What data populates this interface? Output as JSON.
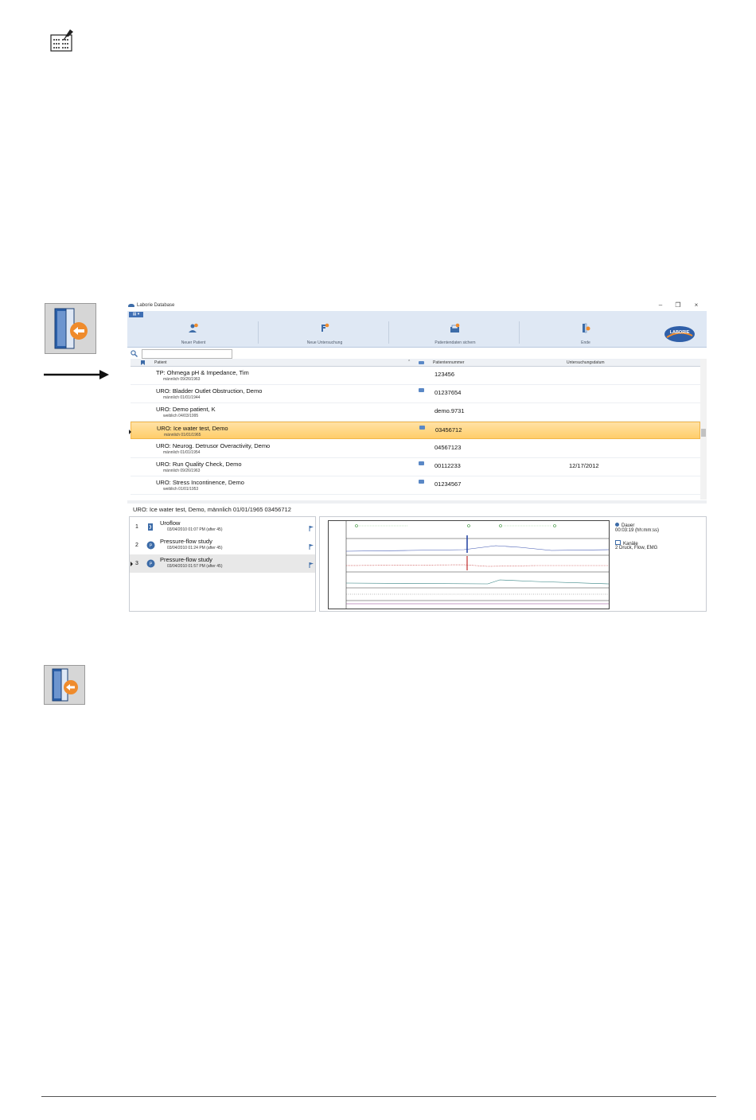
{
  "window": {
    "title": "Laborie Database",
    "minimize": "–",
    "restore": "❐",
    "close": "×",
    "menu_button": "▤ ▾"
  },
  "ribbon": {
    "buttons": [
      {
        "label": "Neuer Patient",
        "icon": "new-patient-icon"
      },
      {
        "label": "Neue Untersuchung",
        "icon": "new-examination-icon"
      },
      {
        "label": "Patientendaten sichern",
        "icon": "save-patient-data-icon"
      },
      {
        "label": "Ende",
        "icon": "exit-icon"
      }
    ],
    "logo": "LABORIE"
  },
  "table": {
    "headers": {
      "patient": "Patient",
      "sort": "⌃",
      "number": "Patientennummer",
      "date": "Untersuchungsdatum"
    },
    "rows": [
      {
        "name": "TP: Ohmega pH & Impedance, Tim",
        "sub": "männlich 09/26/1963",
        "number": "123456",
        "date": "",
        "has_file": false,
        "selected": false
      },
      {
        "name": "URO: Bladder Outlet Obstruction, Demo",
        "sub": "männlich 01/01/1944",
        "number": "01237654",
        "date": "",
        "has_file": true,
        "selected": false
      },
      {
        "name": "URO: Demo patient, K",
        "sub": "weiblich 04/03/1995",
        "number": "demo.9731",
        "date": "",
        "has_file": false,
        "selected": false
      },
      {
        "name": "URO: Ice water test, Demo",
        "sub": "männlich 01/01/1965",
        "number": "03456712",
        "date": "",
        "has_file": true,
        "selected": true
      },
      {
        "name": "URO: Neurog. Detrusor Overactivity, Demo",
        "sub": "männlich 01/01/1954",
        "number": "04567123",
        "date": "",
        "has_file": false,
        "selected": false
      },
      {
        "name": "URO: Run Quality Check, Demo",
        "sub": "männlich 09/26/1963",
        "number": "00112233",
        "date": "12/17/2012",
        "has_file": true,
        "selected": false
      },
      {
        "name": "URO: Stress Incontinence, Demo",
        "sub": "weiblich 01/01/1953",
        "number": "01234567",
        "date": "",
        "has_file": true,
        "selected": false
      }
    ]
  },
  "detail": {
    "info": "URO: Ice water test, Demo, männlich 01/01/1965 03456712",
    "sessions": [
      {
        "index": "1",
        "title": "Uroflow",
        "date": "03/04/2010 01:07 PM (after 45)",
        "selected": false
      },
      {
        "index": "2",
        "title": "Pressure-flow study",
        "date": "03/04/2010 01:24 PM (after 45)",
        "selected": false
      },
      {
        "index": "3",
        "title": "Pressure-flow study",
        "date": "03/04/2010 01:57 PM (after 45)",
        "selected": true
      }
    ],
    "duration_label": "Dauer",
    "duration_value": "00:03:19 (hh:mm:ss)",
    "channels_label": "Kanäle",
    "channels_value": "2 Druck, Flow, EMG"
  },
  "colors": {
    "accent": "#3d6ca8",
    "selection": "#ffcd6a",
    "ribbon": "#dfe8f4"
  }
}
